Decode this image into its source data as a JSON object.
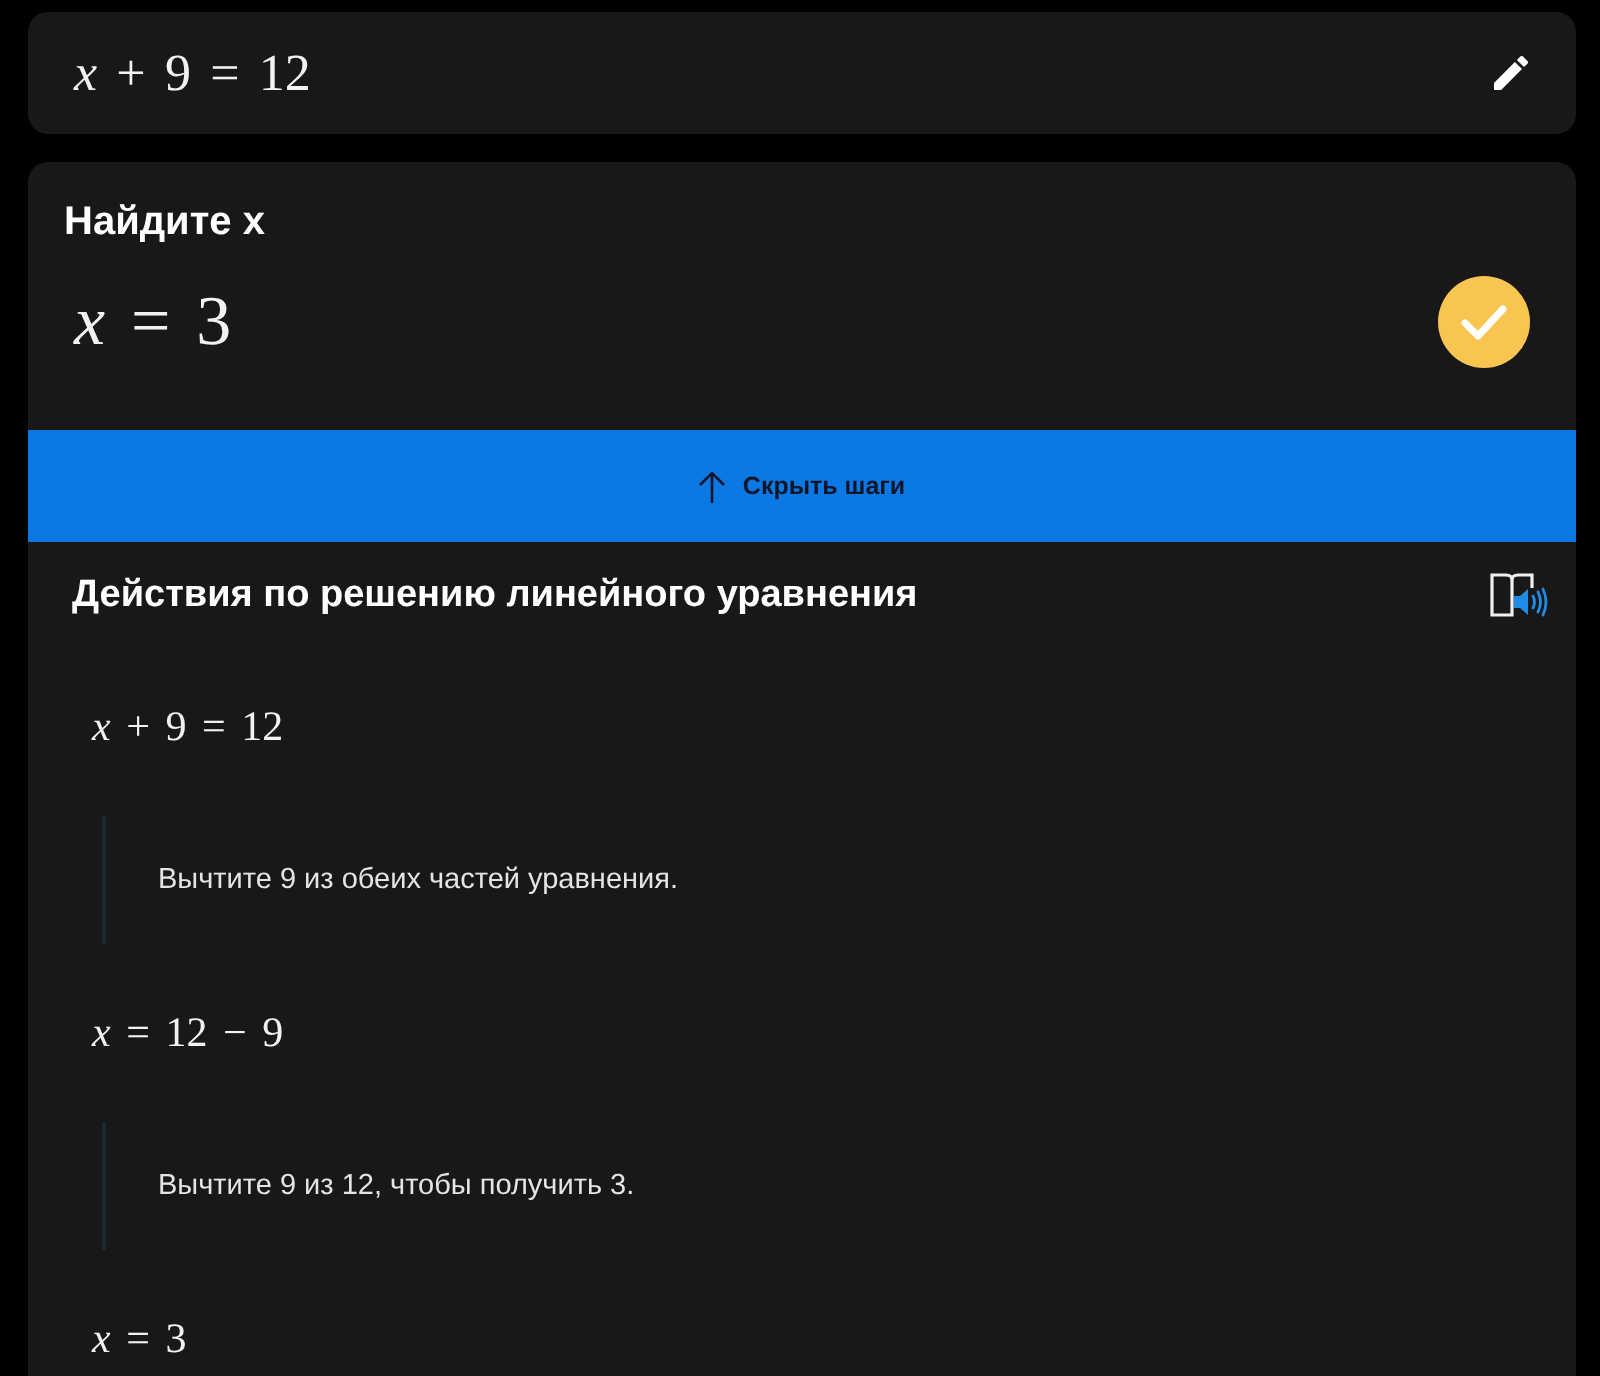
{
  "input": {
    "equation": "*x* + 9 = 12"
  },
  "result": {
    "title": "Найдите x",
    "answer": "*x* = 3",
    "correct": true
  },
  "toggle_button": {
    "label": "Скрыть шаги",
    "expanded": true
  },
  "steps_section": {
    "title": "Действия по решению линейного уравнения",
    "steps": [
      {
        "kind": "equation",
        "text": "*x* + 9 = 12"
      },
      {
        "kind": "explanation",
        "text": "Вычтите 9 из обеих частей уравнения."
      },
      {
        "kind": "equation",
        "text": "*x* = 12 − 9"
      },
      {
        "kind": "explanation",
        "text": "Вычтите 9 из 12, чтобы получить 3."
      },
      {
        "kind": "equation",
        "text": "*x* = 3"
      }
    ]
  }
}
